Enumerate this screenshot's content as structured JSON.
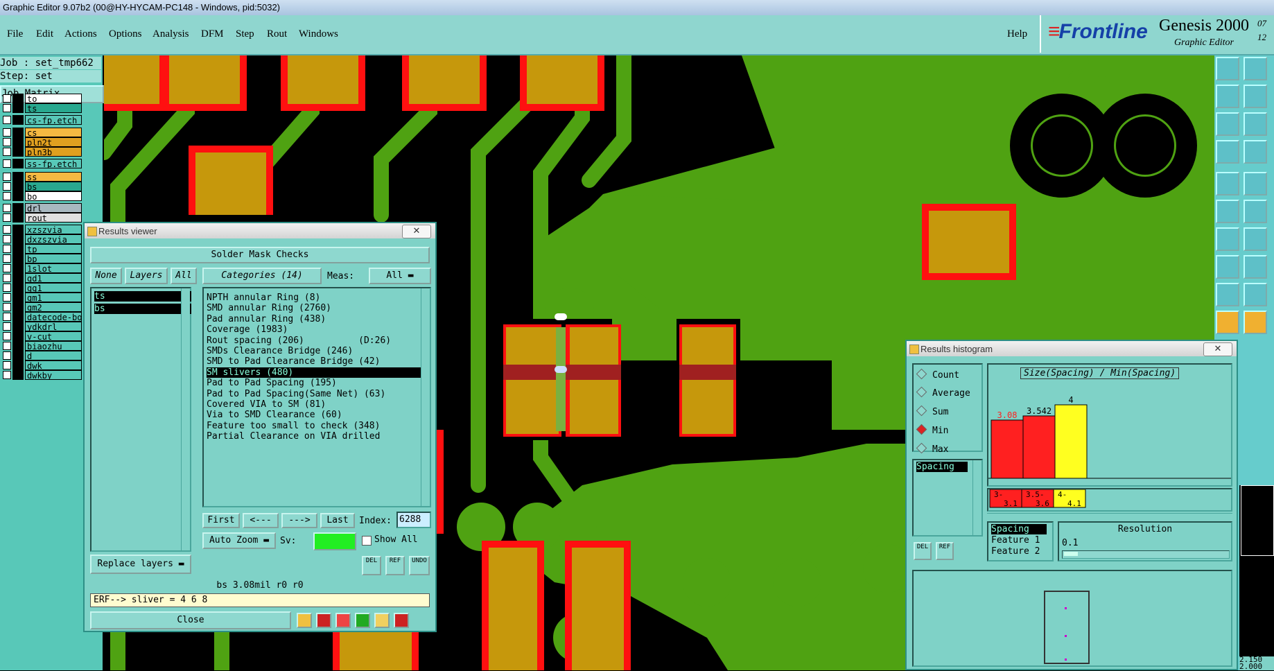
{
  "window": {
    "title": "Graphic Editor 9.07b2 (00@HY-HYCAM-PC148 - Windows, pid:5032)"
  },
  "menu": {
    "items": [
      "File",
      "Edit",
      "Actions",
      "Options",
      "Analysis",
      "DFM",
      "Step",
      "Rout",
      "Windows"
    ],
    "help": "Help"
  },
  "logo": {
    "brand": "Frontline",
    "product": "Genesis 2000",
    "subtitle": "Graphic Editor",
    "version_top": "07",
    "version_bottom": "12"
  },
  "left_panel": {
    "job": "Job : set_tmp662",
    "step": "Step: set",
    "job_matrix": "Job Matrix ...",
    "layers": [
      {
        "name": "to",
        "color": "#ffffff"
      },
      {
        "name": "ts",
        "color": "#29a88f"
      },
      {
        "name": "cs-fp.etch",
        "color": "#58c8b8"
      },
      {
        "name": "cs",
        "color": "#f5b942"
      },
      {
        "name": "pln2t",
        "color": "#e0a020"
      },
      {
        "name": "pln3b",
        "color": "#e0a020"
      },
      {
        "name": "ss-fp.etch",
        "color": "#58c8b8"
      },
      {
        "name": "ss",
        "color": "#f5b942"
      },
      {
        "name": "bs",
        "color": "#29a88f"
      },
      {
        "name": "bo",
        "color": "#ffffff"
      },
      {
        "name": "drl",
        "color": "#a8b8c0"
      },
      {
        "name": "rout",
        "color": "#e0e0e0"
      },
      {
        "name": "xzszvia",
        "color": "#58c8b8"
      },
      {
        "name": "dxzszvia",
        "color": "#58c8b8"
      },
      {
        "name": "tp",
        "color": "#58c8b8"
      },
      {
        "name": "bp",
        "color": "#58c8b8"
      },
      {
        "name": "1slot",
        "color": "#58c8b8"
      },
      {
        "name": "gd1",
        "color": "#58c8b8"
      },
      {
        "name": "gg1",
        "color": "#58c8b8"
      },
      {
        "name": "gm1",
        "color": "#58c8b8"
      },
      {
        "name": "gm2",
        "color": "#58c8b8"
      },
      {
        "name": "datecode-bo",
        "color": "#58c8b8"
      },
      {
        "name": "ydkdrl",
        "color": "#58c8b8"
      },
      {
        "name": "v-cut",
        "color": "#58c8b8"
      },
      {
        "name": "biaozhu",
        "color": "#58c8b8"
      },
      {
        "name": "d",
        "color": "#58c8b8"
      },
      {
        "name": "dwk",
        "color": "#58c8b8"
      },
      {
        "name": "dwkby",
        "color": "#58c8b8"
      }
    ]
  },
  "results_viewer": {
    "title": "Results viewer",
    "header": "Solder Mask Checks",
    "none_btn": "None",
    "layers_btn": "Layers",
    "all_btn": "All",
    "layer_list": [
      "ts",
      "bs"
    ],
    "categories_label": "Categories (14)",
    "meas_label": "Meas:",
    "meas_value": "All",
    "categories": [
      "NPTH annular Ring (8)",
      "SMD annular Ring (2760)",
      "Pad annular Ring (438)",
      "Coverage (1983)",
      "Rout spacing (206)          (D:26)",
      "SMDs Clearance Bridge (246)",
      "SMD to Pad Clearance Bridge (42)",
      "SM slivers (480)",
      "Pad to Pad Spacing (195)",
      "Pad to Pad Spacing(Same Net) (63)",
      "Covered VIA to SM (81)",
      "Via to SMD Clearance (60)",
      "Feature too small to check (348)",
      "Partial Clearance on VIA drilled"
    ],
    "first": "First",
    "prev": "<---",
    "next": "--->",
    "last": "Last",
    "index_label": "Index:",
    "index_value": "6288",
    "auto_zoom": "Auto Zoom",
    "sv_label": "Sv:",
    "show_all": "Show All",
    "replace_layers": "Replace layers",
    "del": "DEL",
    "ref": "REF",
    "undo": "UNDO",
    "status": "bs 3.08mil  r0  r0",
    "erf": "ERF--> sliver = 4 6 8",
    "close": "Close"
  },
  "histogram": {
    "title": "Results histogram",
    "modes": [
      "Count",
      "Average",
      "Sum",
      "Min",
      "Max"
    ],
    "selected_mode": "Min",
    "list_item": "Spacing",
    "chart_title": "Size(Spacing) / Min(Spacing)",
    "del": "DEL",
    "ref": "REF",
    "attr_list": [
      "Spacing",
      "Feature 1",
      "Feature 2"
    ],
    "resolution_label": "Resolution",
    "resolution_value": "0.1",
    "corner_values": [
      "2.150",
      "2.000"
    ]
  },
  "chart_data": {
    "type": "bar",
    "title": "Size(Spacing) / Min(Spacing)",
    "categories": [
      "3-3.1",
      "3.5-3.6",
      "4-4.1"
    ],
    "values": [
      3.08,
      3.542,
      4
    ],
    "value_labels": [
      "3.08",
      "3.542",
      "4"
    ],
    "category_labels_top": [
      "3-",
      "3.5-",
      "4-"
    ],
    "category_labels_bottom": [
      "3.1",
      "3.6",
      "4.1"
    ],
    "colors": [
      "#ff2020",
      "#ff2020",
      "#ffff20"
    ],
    "label_colors": [
      "#ff2020",
      "#000000",
      "#000000"
    ],
    "ylim": [
      0,
      4.5
    ]
  },
  "colors": {
    "copper": "#4fa212",
    "pad": "#c6980c",
    "mask": "#ff1010",
    "board": "#000000",
    "ui": "#7fd2c7"
  }
}
